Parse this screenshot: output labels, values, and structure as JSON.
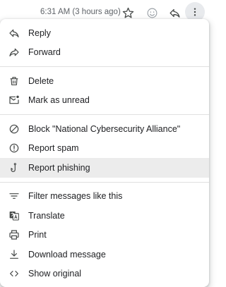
{
  "header": {
    "timestamp": "6:31 AM (3 hours ago)",
    "icons": [
      "star-icon",
      "emoji-icon",
      "reply-icon",
      "more-vert-icon"
    ]
  },
  "menu": {
    "group1": [
      {
        "label": "Reply",
        "icon": "reply-icon"
      },
      {
        "label": "Forward",
        "icon": "forward-icon"
      }
    ],
    "group2": [
      {
        "label": "Delete",
        "icon": "trash-icon"
      },
      {
        "label": "Mark as unread",
        "icon": "mark-unread-icon"
      }
    ],
    "group3": [
      {
        "label": "Block \"National Cybersecurity Alliance\"",
        "icon": "block-icon"
      },
      {
        "label": "Report spam",
        "icon": "report-spam-icon"
      },
      {
        "label": "Report phishing",
        "icon": "fishhook-icon"
      }
    ],
    "group4": [
      {
        "label": "Filter messages like this",
        "icon": "filter-icon"
      },
      {
        "label": "Translate",
        "icon": "translate-icon"
      },
      {
        "label": "Print",
        "icon": "print-icon"
      },
      {
        "label": "Download message",
        "icon": "download-icon"
      },
      {
        "label": "Show original",
        "icon": "code-icon"
      }
    ]
  },
  "colors": {
    "text": "#202124",
    "icon": "#444746",
    "hover_bg": "#ececec",
    "divider": "#e0e0e0"
  }
}
